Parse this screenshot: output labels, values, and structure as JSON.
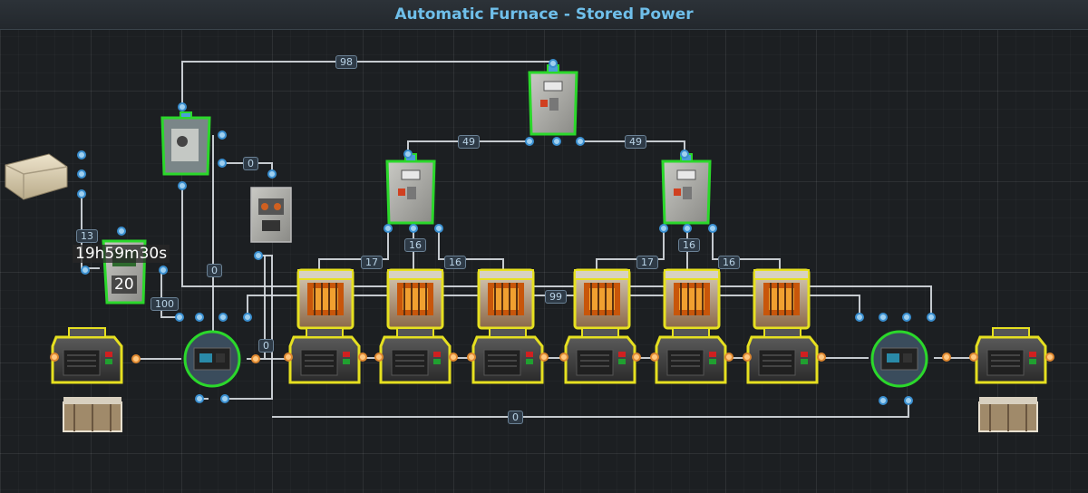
{
  "title": "Automatic Furnace - Stored Power",
  "timer": {
    "text": "19h59m30s",
    "count": "20"
  },
  "labels": {
    "top_98": "98",
    "left_49": "49",
    "right_49": "49",
    "a_0": "0",
    "b_13": "13",
    "c_100": "100",
    "d_0": "0",
    "e_0": "0",
    "f_17": "17",
    "g_16": "16",
    "h_16": "16",
    "i_17": "17",
    "j_16": "16",
    "k_16": "16",
    "l_99": "99",
    "m_0": "0"
  },
  "colors": {
    "accent": "#6fbfea",
    "wire": "#d8dde2",
    "port": "#4a9fd8",
    "power_port": "#f0a040",
    "outline_green": "#2bd82b",
    "outline_yellow": "#e6e020"
  }
}
